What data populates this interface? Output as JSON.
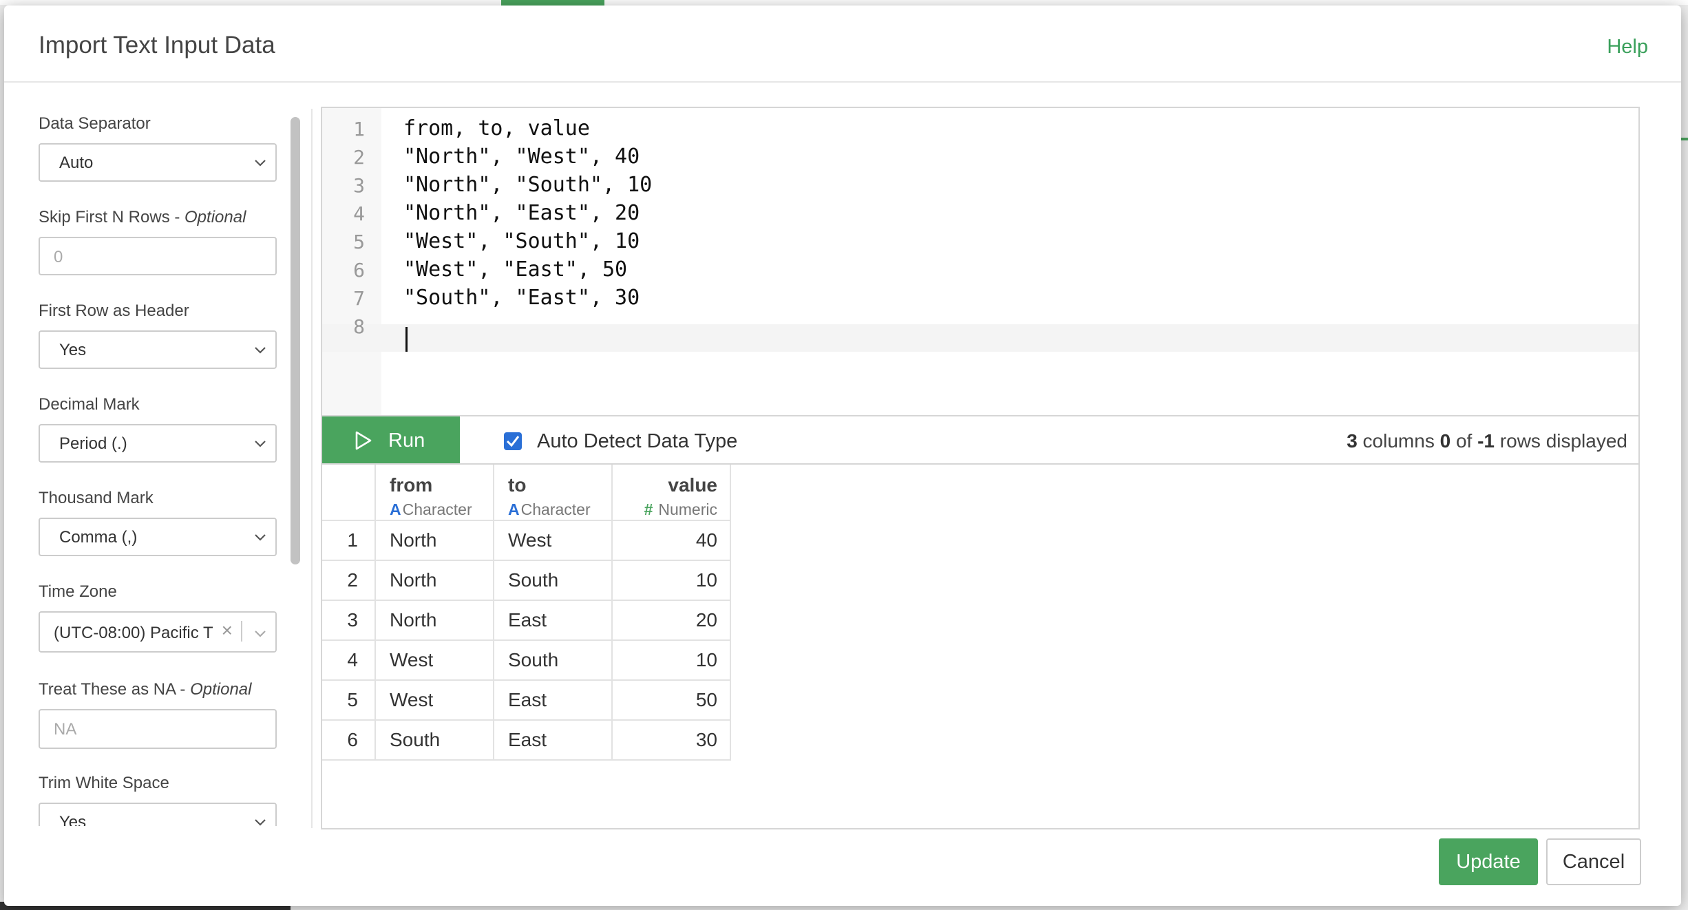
{
  "dialog": {
    "title": "Import Text Input Data",
    "help_label": "Help"
  },
  "sidebar": {
    "data_separator": {
      "label": "Data Separator",
      "value": "Auto"
    },
    "skip_rows": {
      "label": "Skip First N Rows - ",
      "optional": "Optional",
      "placeholder": "0"
    },
    "first_row_header": {
      "label": "First Row as Header",
      "value": "Yes"
    },
    "decimal_mark": {
      "label": "Decimal Mark",
      "value": "Period (.)"
    },
    "thousand_mark": {
      "label": "Thousand Mark",
      "value": "Comma (,)"
    },
    "time_zone": {
      "label": "Time Zone",
      "value": "(UTC-08:00) Pacific T",
      "clear": "×"
    },
    "treat_na": {
      "label": "Treat These as NA - ",
      "optional": "Optional",
      "placeholder": "NA"
    },
    "trim_ws": {
      "label": "Trim White Space",
      "value": "Yes"
    }
  },
  "editor": {
    "line_numbers": [
      "1",
      "2",
      "3",
      "4",
      "5",
      "6",
      "7",
      "8"
    ],
    "lines": [
      "from, to, value",
      "\"North\", \"West\", 40",
      "\"North\", \"South\", 10",
      "\"North\", \"East\", 20",
      "\"West\", \"South\", 10",
      "\"West\", \"East\", 50",
      "\"South\", \"East\", 30",
      ""
    ]
  },
  "toolbar": {
    "run_label": "Run",
    "auto_detect_label": "Auto Detect Data Type",
    "auto_detect_checked": true,
    "summary": {
      "columns_count": "3",
      "columns_label": " columns ",
      "shown": "0",
      "of_label": " of ",
      "total": "-1",
      "rows_label": " rows displayed"
    }
  },
  "table": {
    "columns": [
      {
        "name": "from",
        "type_icon": "A",
        "type": "Character"
      },
      {
        "name": "to",
        "type_icon": "A",
        "type": "Character"
      },
      {
        "name": "value",
        "type_icon": "#",
        "type": "Numeric"
      }
    ],
    "rows": [
      {
        "index": "1",
        "from": "North",
        "to": "West",
        "value": "40"
      },
      {
        "index": "2",
        "from": "North",
        "to": "South",
        "value": "10"
      },
      {
        "index": "3",
        "from": "North",
        "to": "East",
        "value": "20"
      },
      {
        "index": "4",
        "from": "West",
        "to": "South",
        "value": "10"
      },
      {
        "index": "5",
        "from": "West",
        "to": "East",
        "value": "50"
      },
      {
        "index": "6",
        "from": "South",
        "to": "East",
        "value": "30"
      }
    ]
  },
  "footer": {
    "update_label": "Update",
    "cancel_label": "Cancel"
  },
  "colors": {
    "accent": "#4aa45e",
    "checkbox": "#2a6fd6"
  }
}
